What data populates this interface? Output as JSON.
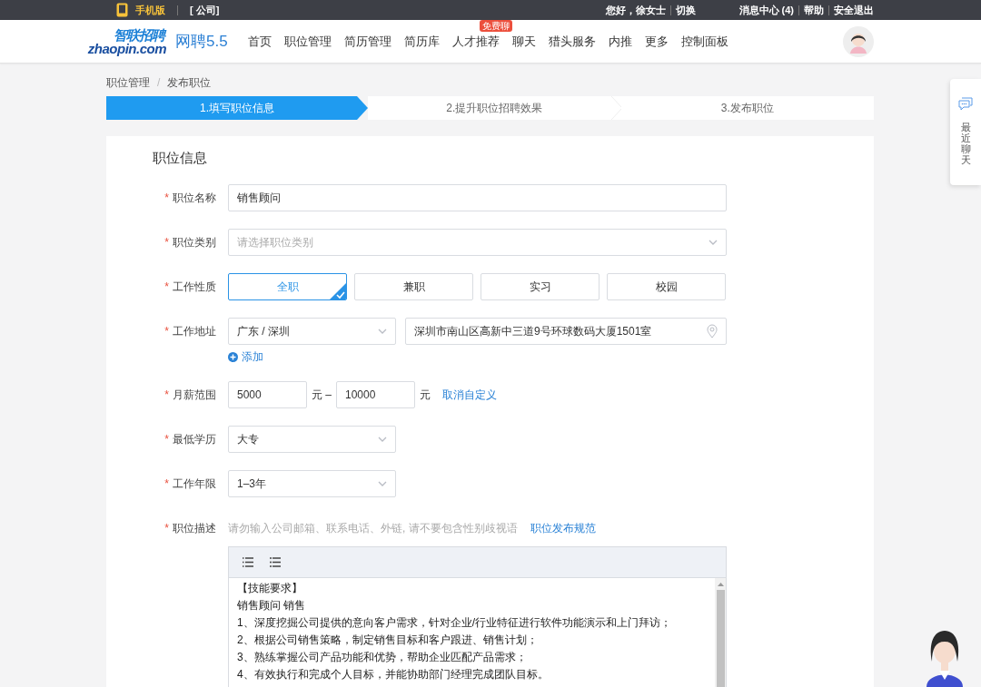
{
  "top_bar": {
    "mobile_label": "手机版",
    "company": "[ 公司]",
    "greeting": "您好，徐女士",
    "switch": "切换",
    "messages": "消息中心 (4)",
    "help": "帮助",
    "logout": "安全退出"
  },
  "header": {
    "logo_cn": "智联招聘",
    "logo_en": "zhaopin.com",
    "product": "网聘5.5",
    "nav": [
      {
        "label": "首页"
      },
      {
        "label": "职位管理"
      },
      {
        "label": "简历管理"
      },
      {
        "label": "简历库"
      },
      {
        "label": "人才推荐",
        "badge": "免费聊"
      },
      {
        "label": "聊天"
      },
      {
        "label": "猎头服务"
      },
      {
        "label": "内推"
      },
      {
        "label": "更多"
      },
      {
        "label": "控制面板"
      }
    ]
  },
  "breadcrumb": {
    "items": [
      "职位管理",
      "发布职位"
    ],
    "separator": "/"
  },
  "steps": [
    {
      "label": "1.填写职位信息",
      "selected": true
    },
    {
      "label": "2.提升职位招聘效果",
      "selected": false
    },
    {
      "label": "3.发布职位",
      "selected": false
    }
  ],
  "form": {
    "title": "职位信息",
    "fields": [
      {
        "kind": "text",
        "label": "职位名称",
        "mark": "*",
        "value": "销售顾问"
      },
      {
        "kind": "wide_select",
        "label": "职位类别",
        "mark": "*",
        "placeholder": "请选择职位类别"
      },
      {
        "kind": "choice",
        "label": "工作性质",
        "mark": "*",
        "options": [
          {
            "label": "全职",
            "selected": true
          },
          {
            "label": "兼职",
            "selected": false
          },
          {
            "label": "实习",
            "selected": false
          },
          {
            "label": "校园",
            "selected": false
          }
        ]
      },
      {
        "kind": "address",
        "label": "工作地址",
        "mark": "*",
        "region": "广东 / 深圳",
        "address": "深圳市南山区高新中三道9号环球数码大厦1501室",
        "add_label": "添加"
      },
      {
        "kind": "range",
        "label": "月薪范围",
        "mark": "*",
        "min": "5000",
        "from_unit": "元",
        "dash": "–",
        "max": "10000",
        "to_unit": "元",
        "link": "取消自定义"
      },
      {
        "kind": "select",
        "label": "最低学历",
        "mark": "*",
        "value": "大专"
      },
      {
        "kind": "select",
        "label": "工作年限",
        "mark": "*",
        "value": "1–3年"
      },
      {
        "kind": "editor",
        "label": "职位描述",
        "mark": "*",
        "hint": "请勿输入公司邮箱、联系电话、外链, 请不要包含性别歧视语",
        "link": "职位发布规范",
        "lines": [
          "【技能要求】",
          "销售顾问 销售",
          "1、深度挖掘公司提供的意向客户需求，针对企业/行业特征进行软件功能演示和上门拜访；",
          "2、根据公司销售策略，制定销售目标和客户跟进、销售计划；",
          "3、熟练掌握公司产品功能和优势，帮助企业匹配产品需求；",
          "4、有效执行和完成个人目标，并能协助部门经理完成团队目标。"
        ]
      }
    ]
  },
  "side_chat": {
    "label": "最近聊天"
  }
}
